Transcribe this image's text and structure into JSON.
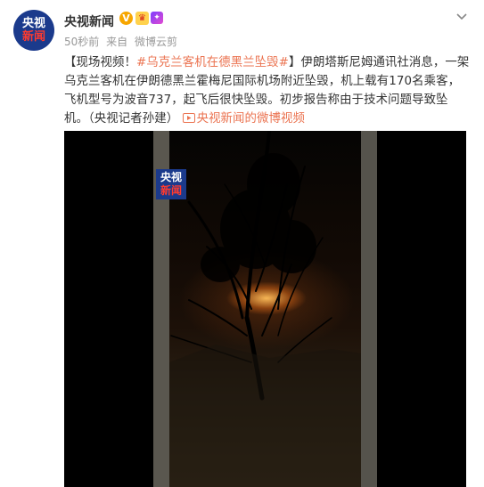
{
  "account": {
    "name": "央视新闻",
    "avatar_line1": "央视",
    "avatar_line2": "新闻",
    "verified_mark": "V"
  },
  "post_meta": {
    "time": "50秒前",
    "source_prefix": "来自",
    "source": "微博云剪"
  },
  "post": {
    "bracket_open": "【",
    "tag_label": "现场视频！",
    "hashtag": "#乌克兰客机在德黑兰坠毁#",
    "bracket_close": "】",
    "body": "伊朗塔斯尼姆通讯社消息，一架乌克兰客机在伊朗德黑兰霍梅尼国际机场附近坠毁，机上载有170名乘客，飞机型号为波音737，起飞后很快坠毁。初步报告称由于技术问题导致坠机。（央视记者孙建）",
    "video_link": "央视新闻的微博视频"
  },
  "video": {
    "watermark_line1": "央视",
    "watermark_line2": "新闻"
  },
  "icons": {
    "verified": "verified-badge-icon",
    "badge1": "vip-badge-icon",
    "badge2": "member-badge-icon",
    "more": "chevron-down-icon",
    "video_link": "video-icon"
  },
  "colors": {
    "accent": "#eb7350",
    "avatar_bg": "#1b3a8c",
    "meta": "#999999"
  }
}
